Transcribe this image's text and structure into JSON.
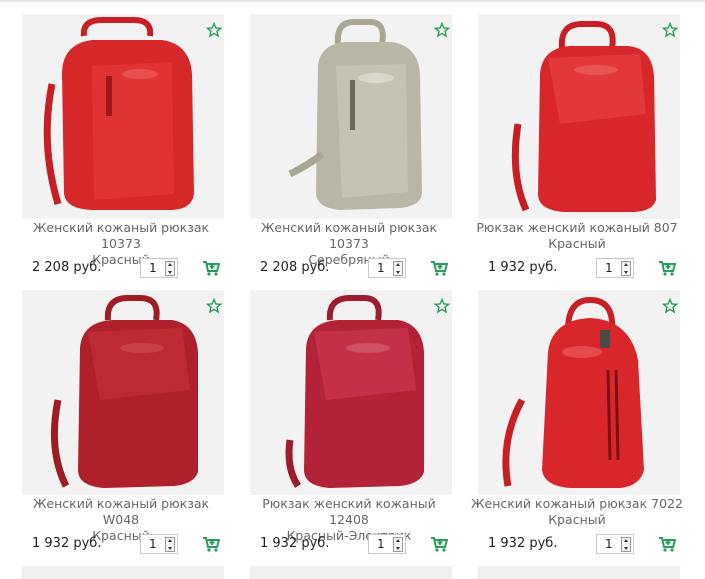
{
  "currency_accent": "#2a9d5a",
  "products": [
    {
      "title_line1": "Женский кожаный рюкзак 10373",
      "title_line2": "Красный",
      "price": "2 208 руб.",
      "qty": "1",
      "bag_color": "#d62828",
      "fav_icon": "star-outline-icon",
      "cart_icon": "cart-plus-icon"
    },
    {
      "title_line1": "Женский кожаный рюкзак 10373",
      "title_line2": "Серебряный",
      "price": "2 208 руб.",
      "qty": "1",
      "bag_color": "#b9b6a6",
      "fav_icon": "star-outline-icon",
      "cart_icon": "cart-plus-icon"
    },
    {
      "title_line1": "Рюкзак женский кожаный 807",
      "title_line2": "Красный",
      "price": "1 932 руб.",
      "qty": "1",
      "bag_color": "#d8262a",
      "fav_icon": "star-outline-icon",
      "cart_icon": "cart-plus-icon"
    },
    {
      "title_line1": "Женский кожаный рюкзак W048",
      "title_line2": "Красный",
      "price": "1 932 руб.",
      "qty": "1",
      "bag_color": "#b0202a",
      "fav_icon": "star-outline-icon",
      "cart_icon": "cart-plus-icon"
    },
    {
      "title_line1": "Рюкзак женский кожаный 12408",
      "title_line2": "Красный-Электрик",
      "price": "1 932 руб.",
      "qty": "1",
      "bag_color": "#b42238",
      "fav_icon": "star-outline-icon",
      "cart_icon": "cart-plus-icon"
    },
    {
      "title_line1": "Женский кожаный рюкзак 7022",
      "title_line2": "Красный",
      "price": "1 932 руб.",
      "qty": "1",
      "bag_color": "#d8262a",
      "fav_icon": "star-outline-icon",
      "cart_icon": "cart-plus-icon"
    }
  ]
}
